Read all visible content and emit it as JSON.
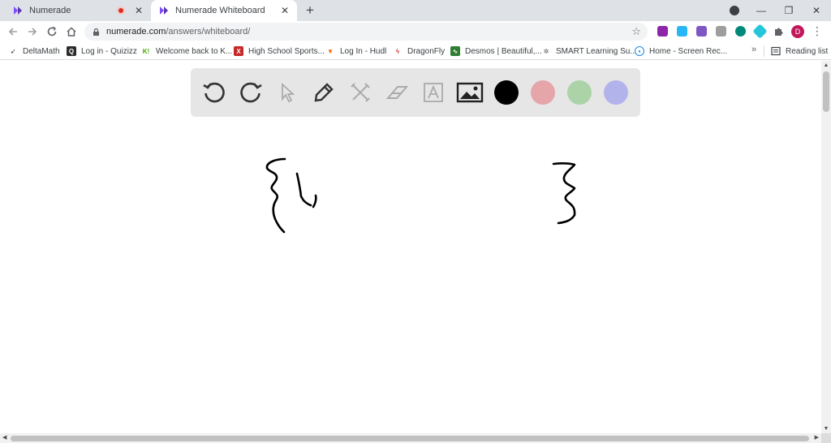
{
  "tabs": [
    {
      "title": "Numerade",
      "active": false,
      "recording": true
    },
    {
      "title": "Numerade Whiteboard",
      "active": true,
      "recording": false
    }
  ],
  "new_tab_label": "+",
  "window_controls": {
    "minimize": "—",
    "restore": "❐",
    "close": "✕"
  },
  "omnibox": {
    "domain": "numerade.com",
    "path": "/answers/whiteboard/"
  },
  "profile_initial": "D",
  "bookmarks": [
    {
      "label": "DeltaMath",
      "icon": "deltamath-icon",
      "color": "#2b2b2b"
    },
    {
      "label": "Log in - Quizizz",
      "icon": "quizizz-icon",
      "color": "#2b2b2b"
    },
    {
      "label": "Welcome back to K...",
      "icon": "kahoot-icon",
      "color": "#46a800"
    },
    {
      "label": "High School Sports...",
      "icon": "highschool-sports-icon",
      "color": "#c62828"
    },
    {
      "label": "Log In - Hudl",
      "icon": "hudl-icon",
      "color": "#ff6300"
    },
    {
      "label": "DragonFly",
      "icon": "dragonfly-icon",
      "color": "#d32f2f"
    },
    {
      "label": "Desmos | Beautiful,...",
      "icon": "desmos-icon",
      "color": "#2e7d32"
    },
    {
      "label": "SMART Learning Su...",
      "icon": "smart-icon",
      "color": "#555555"
    },
    {
      "label": "Home - Screen Rec...",
      "icon": "screen-rec-icon",
      "color": "#1e88e5"
    }
  ],
  "bookmarks_more": "»",
  "reading_list": "Reading list",
  "whiteboard": {
    "tools": [
      "undo-icon",
      "redo-icon",
      "select-icon",
      "pen-icon",
      "shapes-icon",
      "eraser-icon",
      "text-icon",
      "image-icon"
    ],
    "colors": [
      {
        "name": "black",
        "hex": "#000000",
        "selected": true
      },
      {
        "name": "red",
        "hex": "#e6a5a9",
        "selected": false
      },
      {
        "name": "green",
        "hex": "#acd3a8",
        "selected": false
      },
      {
        "name": "blue",
        "hex": "#b3b3ec",
        "selected": false
      }
    ]
  }
}
